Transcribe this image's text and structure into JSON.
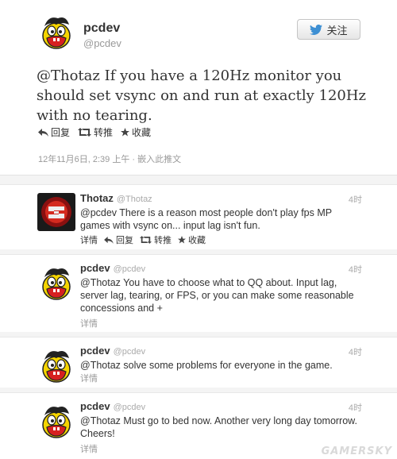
{
  "main_tweet": {
    "name": "pcdev",
    "handle": "@pcdev",
    "follow_label": "关注",
    "text": "@Thotaz If you have a 120Hz monitor you should set vsync on and run at exactly 120Hz with no tearing.",
    "actions": {
      "reply": "回复",
      "retweet": "转推",
      "favorite": "收藏"
    },
    "timestamp": "12年11月6日, 2:39 上午",
    "embed": "嵌入此推文"
  },
  "replies": [
    {
      "name": "Thotaz",
      "handle": "@Thotaz",
      "time": "4时",
      "text": "@pcdev There is a reason most people don't play fps MP games with vsync on... input lag isn't fun.",
      "details": "详情",
      "reply": "回复",
      "retweet": "转推",
      "favorite": "收藏"
    },
    {
      "name": "pcdev",
      "handle": "@pcdev",
      "time": "4时",
      "text": "@Thotaz You have to choose what to QQ about. Input lag, server lag, tearing, or FPS, or you can make some reasonable concessions and +",
      "details": "详情"
    },
    {
      "name": "pcdev",
      "handle": "@pcdev",
      "time": "4时",
      "text": "@Thotaz solve some problems for everyone in the game.",
      "details": "详情"
    },
    {
      "name": "pcdev",
      "handle": "@pcdev",
      "time": "4时",
      "text": "@Thotaz Must go to bed now. Another very long day tomorrow. Cheers!",
      "details": "详情"
    }
  ],
  "watermark": "GAMERSKY",
  "colors": {
    "avatar_yellow": "#f5d400",
    "twitter_blue": "#3d8fd3"
  },
  "icons": [
    "twitter-bird-icon",
    "reply-icon",
    "retweet-icon",
    "star-icon"
  ]
}
